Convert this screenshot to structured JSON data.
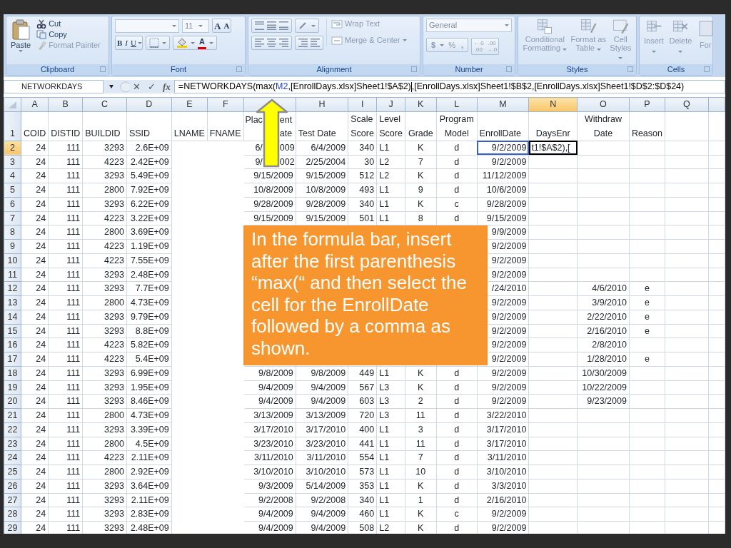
{
  "ribbon": {
    "clipboard": {
      "label": "Clipboard",
      "paste": "Paste",
      "cut": "Cut",
      "copy": "Copy",
      "format_painter": "Format Painter",
      "disabled": false
    },
    "font": {
      "label": "Font",
      "size": "11",
      "grow": "A",
      "shrink": "A",
      "bold": "B",
      "italic": "I",
      "underline": "U",
      "font_color": "A",
      "disabled": false
    },
    "alignment": {
      "label": "Alignment",
      "wrap_text": "Wrap Text",
      "merge_center": "Merge & Center",
      "disabled": true
    },
    "number": {
      "label": "Number",
      "format": "General",
      "currency": "$",
      "percent": "%",
      "comma": ",",
      "increase_decimal": [
        "←.0",
        ".00"
      ],
      "decrease_decimal": [
        ".00",
        "→.0"
      ],
      "disabled": true
    },
    "styles": {
      "label": "Styles",
      "conditional": "Conditional Formatting",
      "format_table": "Format as Table",
      "cell_styles": "Cell Styles",
      "disabled": true
    },
    "cells": {
      "label": "Cells",
      "insert": "Insert",
      "delete": "Delete",
      "format": "For",
      "disabled": true
    }
  },
  "formula_bar": {
    "name_box": "NETWORKDAYS",
    "cancel": "✕",
    "enter": "✓",
    "fx": "fx",
    "formula": [
      {
        "text": "=NETWORKDAYS(max(",
        "color": "#000000",
        "cursor_after": false
      },
      {
        "text": "M2",
        "color": "#1f3fd8",
        "cursor_after": false
      },
      {
        "text": ",[EnrollDays.xlsx]Sheet1!$A$2)",
        "color": "#000000",
        "cursor_after": true
      },
      {
        "text": ",[EnrollDays.xlsx]Sheet1!$B$2,[EnrollDays.xlsx]Sheet1!$D$2:$D$24)",
        "color": "#000000",
        "cursor_after": false
      }
    ]
  },
  "sheet": {
    "columns": [
      {
        "letter": "A",
        "selected": false
      },
      {
        "letter": "B",
        "selected": false
      },
      {
        "letter": "C",
        "selected": false
      },
      {
        "letter": "D",
        "selected": false
      },
      {
        "letter": "E",
        "selected": false
      },
      {
        "letter": "F",
        "selected": false
      },
      {
        "selected": false
      },
      {
        "letter": "H",
        "selected": false
      },
      {
        "letter": "I",
        "selected": false
      },
      {
        "letter": "J",
        "selected": false
      },
      {
        "letter": "K",
        "selected": false
      },
      {
        "letter": "L",
        "selected": false
      },
      {
        "letter": "M",
        "selected": false
      },
      {
        "letter": "N",
        "selected": true
      },
      {
        "letter": "O",
        "selected": false
      },
      {
        "letter": "P",
        "selected": false
      },
      {
        "letter": "Q",
        "selected": false
      }
    ],
    "header_row": {
      "number": "1",
      "selected": false,
      "cells": [
        "COID",
        "DISTID",
        "BUILDID",
        "SSID",
        "LNAME",
        "FNAME",
        [
          "Plac",
          "ent",
          "ate"
        ],
        "Test Date",
        "Scale Score",
        "Level Score",
        "Grade",
        "Program Model",
        "EnrollDate",
        "DaysEnr",
        "Withdraw Date",
        "Reason",
        null
      ]
    },
    "rows": [
      {
        "number": "2",
        "selected": true,
        "cells": [
          "24",
          "111",
          "3293",
          "2.6E+09",
          null,
          null,
          [
            "6/",
            "009"
          ],
          "6/4/2009",
          "340",
          "L1",
          "K",
          "d",
          {
            "text": "9/2/2009",
            "referenced": true
          },
          "t1!$A$2),[",
          null,
          null,
          null
        ]
      },
      {
        "number": "3",
        "selected": false,
        "cells": [
          "24",
          "111",
          "4223",
          "2.42E+09",
          null,
          null,
          [
            "9/",
            "002"
          ],
          "2/25/2004",
          "30",
          "L2",
          "7",
          "d",
          "9/2/2009",
          null,
          null,
          null,
          null
        ]
      },
      {
        "number": "4",
        "selected": false,
        "cells": [
          "24",
          "111",
          "3293",
          "5.49E+09",
          null,
          null,
          "9/15/2009",
          "9/15/2009",
          "512",
          "L2",
          "K",
          "d",
          "11/12/2009",
          null,
          null,
          null,
          null
        ]
      },
      {
        "number": "5",
        "selected": false,
        "cells": [
          "24",
          "111",
          "2800",
          "7.92E+09",
          null,
          null,
          "10/8/2009",
          "10/8/2009",
          "493",
          "L1",
          "9",
          "d",
          "10/6/2009",
          null,
          null,
          null,
          null
        ]
      },
      {
        "number": "6",
        "selected": false,
        "cells": [
          "24",
          "111",
          "3293",
          "6.22E+09",
          null,
          null,
          "9/28/2009",
          "9/28/2009",
          "340",
          "L1",
          "K",
          "c",
          "9/28/2009",
          null,
          null,
          null,
          null
        ]
      },
      {
        "number": "7",
        "selected": false,
        "cells": [
          "24",
          "111",
          "4223",
          "3.22E+09",
          null,
          null,
          "9/15/2009",
          "9/15/2009",
          "501",
          "L1",
          "8",
          "d",
          "9/15/2009",
          null,
          null,
          null,
          null
        ]
      },
      {
        "number": "8",
        "selected": false,
        "cells": [
          "24",
          "111",
          "2800",
          "3.69E+09",
          null,
          null,
          null,
          null,
          null,
          null,
          null,
          null,
          "9/9/2009",
          null,
          null,
          null,
          null
        ]
      },
      {
        "number": "9",
        "selected": false,
        "cells": [
          "24",
          "111",
          "4223",
          "1.19E+09",
          null,
          null,
          null,
          null,
          null,
          null,
          null,
          null,
          "9/2/2009",
          null,
          null,
          null,
          null
        ]
      },
      {
        "number": "10",
        "selected": false,
        "cells": [
          "24",
          "111",
          "4223",
          "7.55E+09",
          null,
          null,
          null,
          null,
          null,
          null,
          null,
          null,
          "9/2/2009",
          null,
          null,
          null,
          null
        ]
      },
      {
        "number": "11",
        "selected": false,
        "cells": [
          "24",
          "111",
          "3293",
          "2.48E+09",
          null,
          null,
          null,
          null,
          null,
          null,
          null,
          null,
          "9/2/2009",
          null,
          null,
          null,
          null
        ]
      },
      {
        "number": "12",
        "selected": false,
        "cells": [
          "24",
          "111",
          "3293",
          "7.7E+09",
          null,
          null,
          null,
          null,
          null,
          null,
          null,
          null,
          "/24/2010",
          null,
          "4/6/2010",
          "e",
          null
        ]
      },
      {
        "number": "13",
        "selected": false,
        "cells": [
          "24",
          "111",
          "2800",
          "4.73E+09",
          null,
          null,
          null,
          null,
          null,
          null,
          null,
          null,
          "9/2/2009",
          null,
          "3/9/2010",
          "e",
          null
        ]
      },
      {
        "number": "14",
        "selected": false,
        "cells": [
          "24",
          "111",
          "3293",
          "9.79E+09",
          null,
          null,
          null,
          null,
          null,
          null,
          null,
          null,
          "9/2/2009",
          null,
          "2/22/2010",
          "e",
          null
        ]
      },
      {
        "number": "15",
        "selected": false,
        "cells": [
          "24",
          "111",
          "3293",
          "8.8E+09",
          null,
          null,
          null,
          null,
          null,
          null,
          null,
          null,
          "9/2/2009",
          null,
          "2/16/2010",
          "e",
          null
        ]
      },
      {
        "number": "16",
        "selected": false,
        "cells": [
          "24",
          "111",
          "4223",
          "5.82E+09",
          null,
          null,
          null,
          null,
          null,
          null,
          null,
          null,
          "9/2/2009",
          null,
          "2/8/2010",
          null,
          null
        ]
      },
      {
        "number": "17",
        "selected": false,
        "cells": [
          "24",
          "111",
          "4223",
          "5.4E+09",
          null,
          null,
          null,
          null,
          null,
          null,
          null,
          null,
          "9/2/2009",
          null,
          "1/28/2010",
          "e",
          null
        ]
      },
      {
        "number": "18",
        "selected": false,
        "cells": [
          "24",
          "111",
          "3293",
          "6.99E+09",
          null,
          null,
          "9/8/2009",
          "9/8/2009",
          "449",
          "L1",
          "K",
          "d",
          "9/2/2009",
          null,
          "10/30/2009",
          null,
          null
        ]
      },
      {
        "number": "19",
        "selected": false,
        "cells": [
          "24",
          "111",
          "3293",
          "1.95E+09",
          null,
          null,
          "9/4/2009",
          "9/4/2009",
          "567",
          "L3",
          "K",
          "d",
          "9/2/2009",
          null,
          "10/22/2009",
          null,
          null
        ]
      },
      {
        "number": "20",
        "selected": false,
        "cells": [
          "24",
          "111",
          "3293",
          "8.46E+09",
          null,
          null,
          "9/4/2009",
          "9/4/2009",
          "603",
          "L3",
          "2",
          "d",
          "9/2/2009",
          null,
          "9/23/2009",
          null,
          null
        ]
      },
      {
        "number": "21",
        "selected": false,
        "cells": [
          "24",
          "111",
          "2800",
          "4.73E+09",
          null,
          null,
          "3/13/2009",
          "3/13/2009",
          "720",
          "L3",
          "11",
          "d",
          "3/22/2010",
          null,
          null,
          null,
          null
        ]
      },
      {
        "number": "22",
        "selected": false,
        "cells": [
          "24",
          "111",
          "3293",
          "3.39E+09",
          null,
          null,
          "3/17/2010",
          "3/17/2010",
          "400",
          "L1",
          "3",
          "d",
          "3/17/2010",
          null,
          null,
          null,
          null
        ]
      },
      {
        "number": "23",
        "selected": false,
        "cells": [
          "24",
          "111",
          "2800",
          "4.5E+09",
          null,
          null,
          "3/23/2010",
          "3/23/2010",
          "441",
          "L1",
          "11",
          "d",
          "3/17/2010",
          null,
          null,
          null,
          null
        ]
      },
      {
        "number": "24",
        "selected": false,
        "cells": [
          "24",
          "111",
          "4223",
          "2.11E+09",
          null,
          null,
          "3/11/2010",
          "3/11/2010",
          "554",
          "L1",
          "7",
          "d",
          "3/11/2010",
          null,
          null,
          null,
          null
        ]
      },
      {
        "number": "25",
        "selected": false,
        "cells": [
          "24",
          "111",
          "2800",
          "2.92E+09",
          null,
          null,
          "3/10/2010",
          "3/10/2010",
          "573",
          "L1",
          "10",
          "d",
          "3/10/2010",
          null,
          null,
          null,
          null
        ]
      },
      {
        "number": "26",
        "selected": false,
        "cells": [
          "24",
          "111",
          "3293",
          "3.64E+09",
          null,
          null,
          "9/3/2009",
          "5/14/2009",
          "353",
          "L1",
          "K",
          "d",
          "3/3/2010",
          null,
          null,
          null,
          null
        ]
      },
      {
        "number": "27",
        "selected": false,
        "cells": [
          "24",
          "111",
          "3293",
          "2.11E+09",
          null,
          null,
          "9/2/2008",
          "9/2/2008",
          "340",
          "L1",
          "1",
          "d",
          "2/16/2010",
          null,
          null,
          null,
          null
        ]
      },
      {
        "number": "28",
        "selected": false,
        "cells": [
          "24",
          "111",
          "3293",
          "2.83E+09",
          null,
          null,
          "9/4/2009",
          "9/4/2009",
          "460",
          "L1",
          "K",
          "c",
          "9/2/2009",
          null,
          null,
          null,
          null
        ]
      },
      {
        "number": "29",
        "selected": false,
        "cells": [
          "24",
          "111",
          "3293",
          "2.48E+09",
          null,
          null,
          "9/4/2009",
          "9/4/2009",
          "508",
          "L2",
          "K",
          "d",
          "9/2/2009",
          null,
          null,
          null,
          null
        ]
      }
    ]
  },
  "callout": {
    "text": "In the formula bar, insert after the first parenthesis “max(“ and then select the cell for the EnrollDate followed by a comma as shown."
  }
}
